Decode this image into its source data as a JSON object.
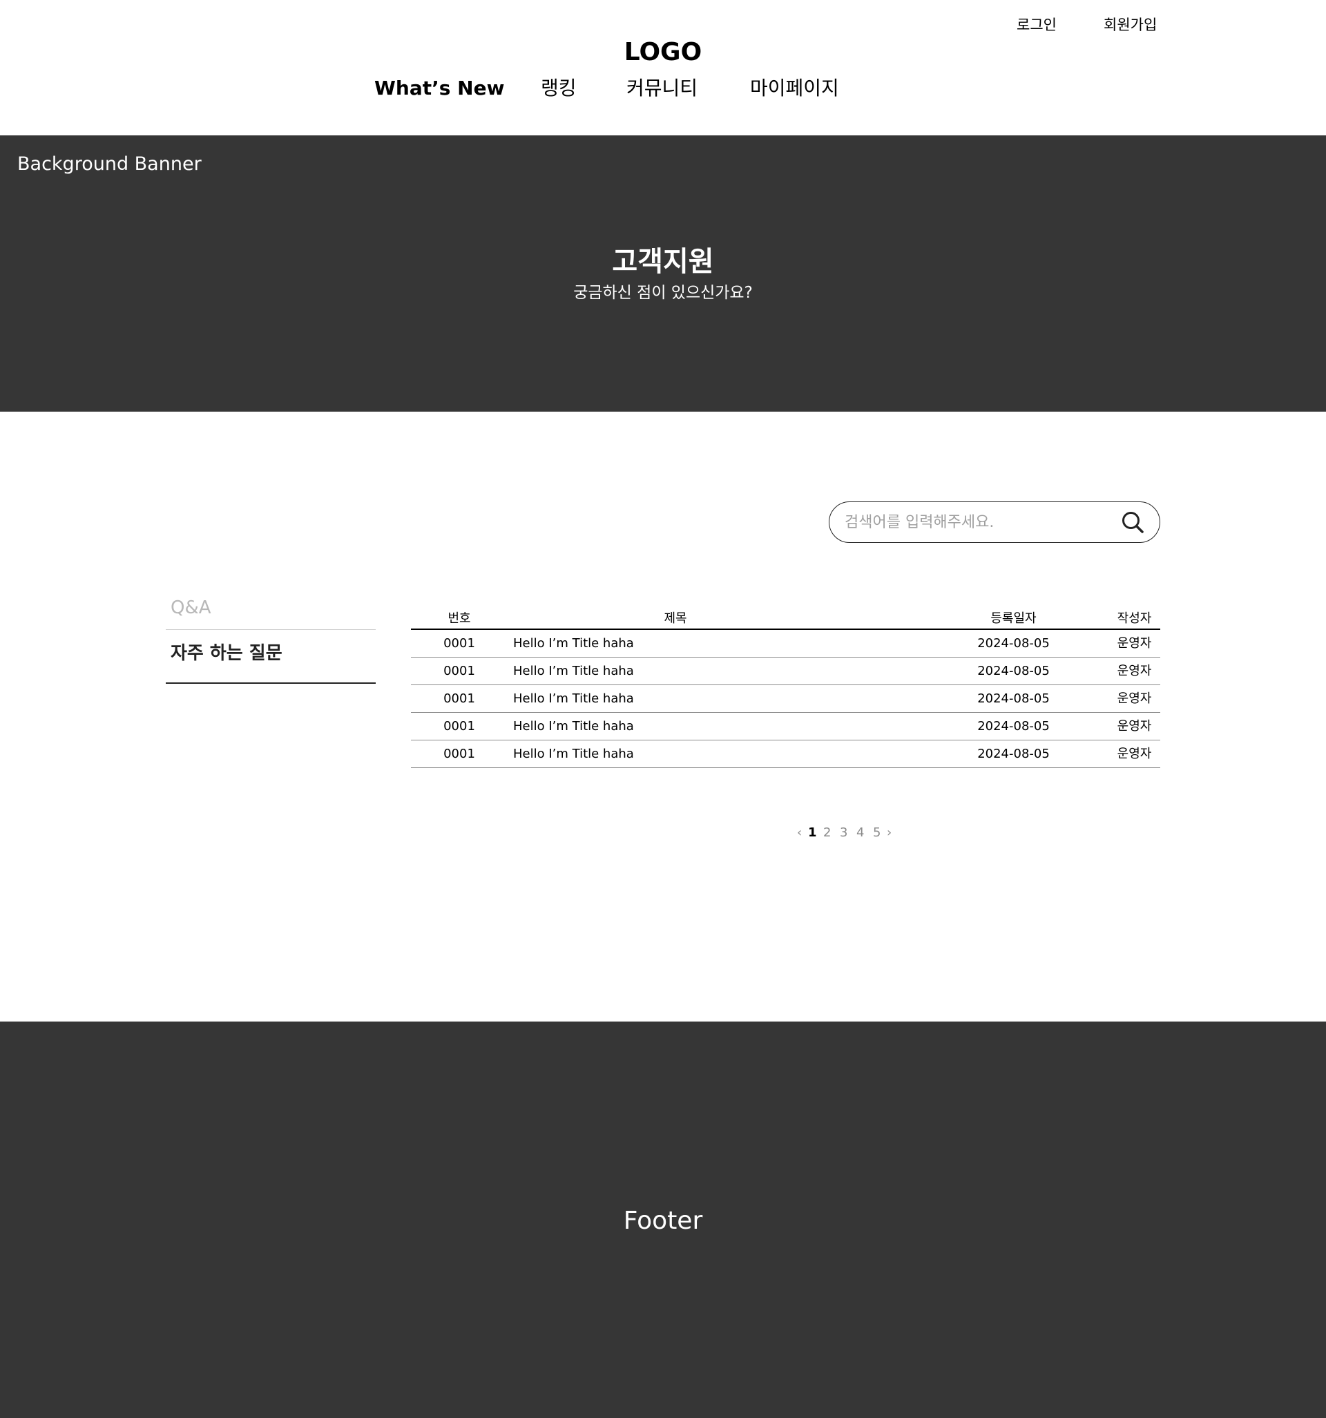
{
  "header": {
    "logo": "LOGO",
    "auth": {
      "login": "로그인",
      "signup": "회원가입"
    },
    "nav": [
      "What’s New",
      "랭킹",
      "커뮤니티",
      "마이페이지"
    ],
    "active_nav": "What’s New"
  },
  "banner": {
    "label": "Background Banner",
    "title": "고객지원",
    "subtitle": "궁금하신 점이 있으신가요?"
  },
  "search": {
    "placeholder": "검색어를 입력해주세요.",
    "value": "",
    "icon": "search-icon"
  },
  "side_menu": {
    "items": [
      "Q&A",
      "자주 하는 질문"
    ],
    "active": "자주 하는 질문"
  },
  "board": {
    "columns": [
      "번호",
      "제목",
      "등록일자",
      "작성자"
    ],
    "rows": [
      {
        "num": "0001",
        "title": "Hello I’m Title haha",
        "date": "2024-08-05",
        "author": "운영자"
      },
      {
        "num": "0001",
        "title": "Hello I’m Title haha",
        "date": "2024-08-05",
        "author": "운영자"
      },
      {
        "num": "0001",
        "title": "Hello I’m Title haha",
        "date": "2024-08-05",
        "author": "운영자"
      },
      {
        "num": "0001",
        "title": "Hello I’m Title haha",
        "date": "2024-08-05",
        "author": "운영자"
      },
      {
        "num": "0001",
        "title": "Hello I’m Title haha",
        "date": "2024-08-05",
        "author": "운영자"
      }
    ]
  },
  "pagination": {
    "prev": "‹",
    "pages": [
      "1",
      "2",
      "3",
      "4",
      "5"
    ],
    "current": "1",
    "next": "›"
  },
  "footer": {
    "text": "Footer"
  },
  "colors": {
    "dark_band": "#363636",
    "text": "#000000",
    "muted": "#b8b8b8",
    "page_inactive": "#8a8a8a"
  }
}
